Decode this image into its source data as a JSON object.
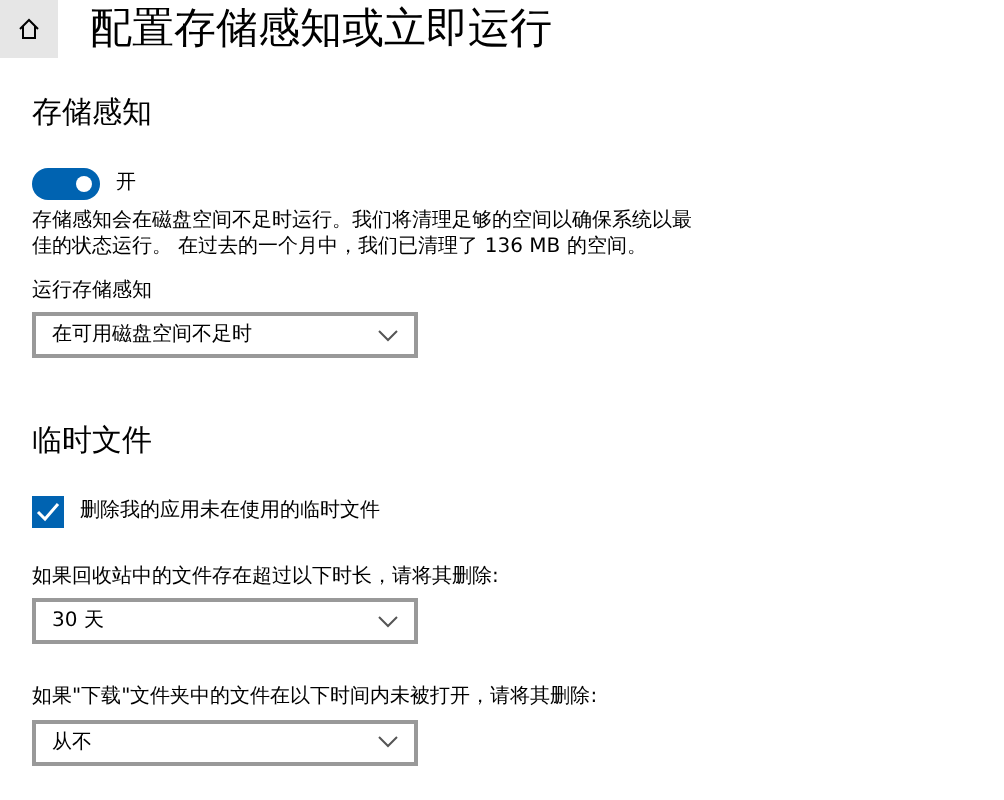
{
  "header": {
    "title": "配置存储感知或立即运行"
  },
  "storage_sense": {
    "heading": "存储感知",
    "toggle": {
      "on": true,
      "label": "开"
    },
    "description": "存储感知会在磁盘空间不足时运行。我们将清理足够的空间以确保系统以最佳的状态运行。 在过去的一个月中，我们已清理了 136 MB 的空间。",
    "run_label": "运行存储感知",
    "run_value": "在可用磁盘空间不足时"
  },
  "temp_files": {
    "heading": "临时文件",
    "checkbox": {
      "label": "删除我的应用未在使用的临时文件",
      "checked": true
    },
    "dropdowns": [
      {
        "label": "如果回收站中的文件存在超过以下时长，请将其删除:",
        "value": "30 天"
      },
      {
        "label": "如果\"下载\"文件夹中的文件在以下时间内未被打开，请将其删除:",
        "value": "从不"
      }
    ]
  }
}
